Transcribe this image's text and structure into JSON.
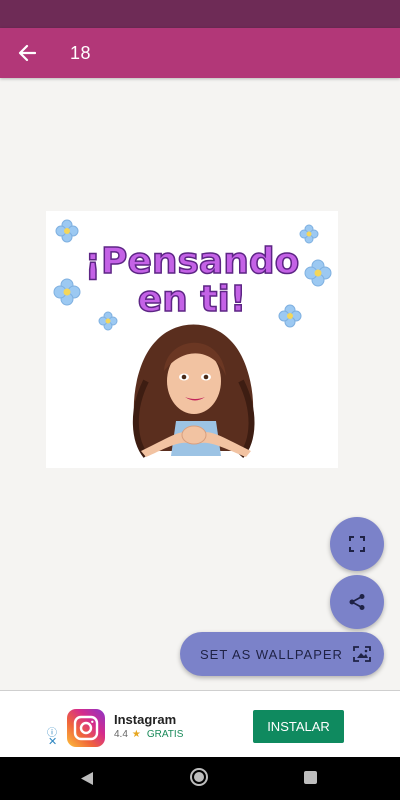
{
  "toolbar": {
    "title": "18"
  },
  "sticker": {
    "line1": "¡Pensando",
    "line2": "en ti!"
  },
  "actions": {
    "set_wallpaper_label": "SET AS WALLPAPER"
  },
  "ad": {
    "app_name": "Instagram",
    "rating": "4.4",
    "price": "GRATIS",
    "cta": "INSTALAR"
  },
  "colors": {
    "status_bar": "#6e2b56",
    "toolbar": "#b23778",
    "fab": "#7b82c9",
    "install_button": "#0f8a5f"
  }
}
